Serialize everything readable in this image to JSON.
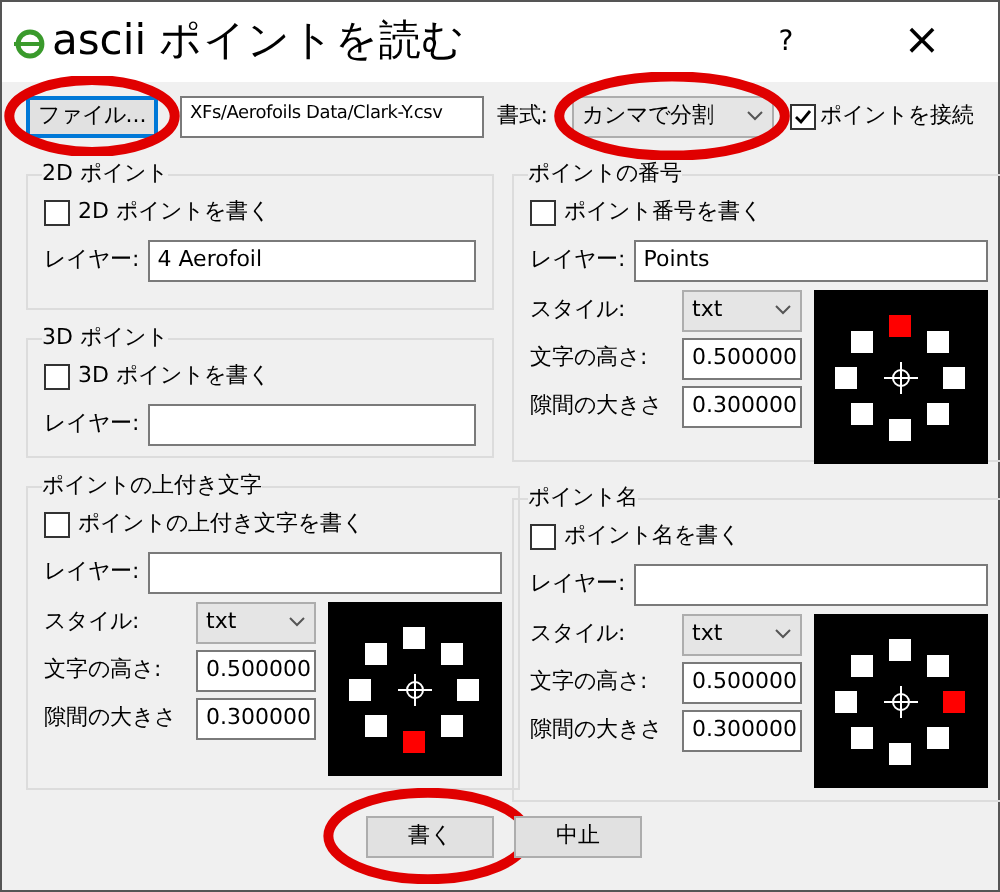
{
  "window": {
    "title": "ascii ポイントを読む",
    "help": "?",
    "close": "×"
  },
  "file_button": {
    "label": "ファイル...",
    "highlighted": true
  },
  "file_path": "XFs/Aerofoils Data/Clark-Y.csv",
  "format": {
    "label": "書式:",
    "value": "カンマで分割",
    "highlighted": true
  },
  "connect": {
    "label": "ポイントを接続",
    "checked": true
  },
  "left_column": [
    {
      "kind": "plain",
      "title": "2D ポイント",
      "checkbox": {
        "label": "2D ポイントを書く",
        "checked": false
      },
      "layer": {
        "label": "レイヤー:",
        "value": "4 Aerofoil"
      }
    },
    {
      "kind": "plain",
      "title": "3D ポイント",
      "checkbox": {
        "label": "3D ポイントを書く",
        "checked": false
      },
      "layer": {
        "label": "レイヤー:"
      }
    },
    {
      "kind": "styled",
      "title": "ポイントの上付き文字",
      "checkbox": {
        "label": "ポイントの上付き文字を書く",
        "checked": false
      },
      "layer": {
        "label": "レイヤー:"
      },
      "style": {
        "label": "スタイル:",
        "value": "txt"
      },
      "height": {
        "label": "文字の高さ:",
        "value": "0.500000"
      },
      "gap": {
        "label": "隙間の大きさ",
        "value": "0.300000"
      },
      "markers": [
        {
          "selected": false
        },
        {
          "selected": false
        },
        {
          "selected": false
        },
        {
          "selected": false
        },
        {
          "selected": true
        },
        {
          "selected": false
        },
        {
          "selected": false
        },
        {
          "selected": false
        }
      ]
    }
  ],
  "right_column": [
    {
      "kind": "styled",
      "title": "ポイントの番号",
      "checkbox": {
        "label": "ポイント番号を書く",
        "checked": false
      },
      "layer": {
        "label": "レイヤー:",
        "value": "Points"
      },
      "style": {
        "label": "スタイル:",
        "value": "txt"
      },
      "height": {
        "label": "文字の高さ:",
        "value": "0.500000"
      },
      "gap": {
        "label": "隙間の大きさ",
        "value": "0.300000"
      },
      "markers": [
        {
          "selected": true
        },
        {
          "selected": false
        },
        {
          "selected": false
        },
        {
          "selected": false
        },
        {
          "selected": false
        },
        {
          "selected": false
        },
        {
          "selected": false
        },
        {
          "selected": false
        }
      ]
    },
    {
      "kind": "styled",
      "title": "ポイント名",
      "checkbox": {
        "label": "ポイント名を書く",
        "checked": false
      },
      "layer": {
        "label": "レイヤー:"
      },
      "style": {
        "label": "スタイル:",
        "value": "txt"
      },
      "height": {
        "label": "文字の高さ:",
        "value": "0.500000"
      },
      "gap": {
        "label": "隙間の大きさ",
        "value": "0.300000"
      },
      "markers": [
        {
          "selected": false
        },
        {
          "selected": false
        },
        {
          "selected": true
        },
        {
          "selected": false
        },
        {
          "selected": false
        },
        {
          "selected": false
        },
        {
          "selected": false
        },
        {
          "selected": false
        }
      ]
    }
  ],
  "buttons": [
    {
      "label": "書く",
      "highlighted": true
    },
    {
      "label": "中止",
      "highlighted": false
    }
  ]
}
